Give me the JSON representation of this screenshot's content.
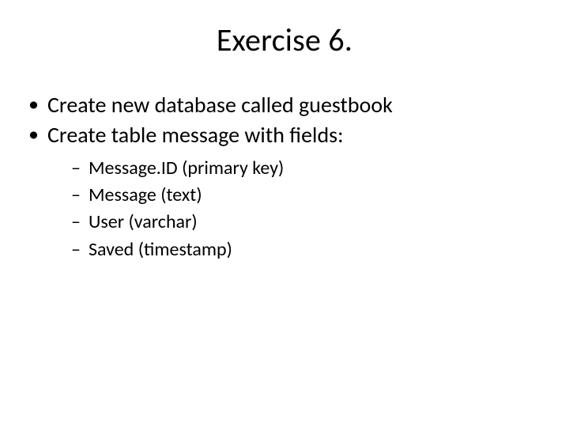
{
  "title": "Exercise 6.",
  "bullets": {
    "b1": "Create new database called guestbook",
    "b2": "Create table message with fields:",
    "sub": {
      "s1": "Message.ID (primary key)",
      "s2": "Message (text)",
      "s3": "User  (varchar)",
      "s4": "Saved (timestamp)"
    }
  }
}
